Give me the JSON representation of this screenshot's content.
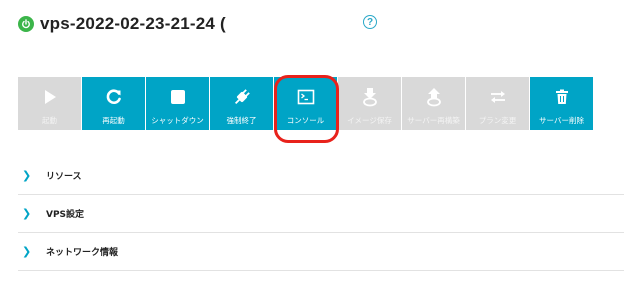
{
  "header": {
    "server_name": "vps-2022-02-23-21-24 (",
    "status_color": "#3cb54a",
    "help_label": "?"
  },
  "toolbar": {
    "accent_color": "#00a4c6",
    "disabled_color": "#d9d9d9",
    "buttons": [
      {
        "label": "起動",
        "icon": "play-icon",
        "enabled": false
      },
      {
        "label": "再起動",
        "icon": "restart-icon",
        "enabled": true
      },
      {
        "label": "シャットダウン",
        "icon": "stop-icon",
        "enabled": true
      },
      {
        "label": "強制終了",
        "icon": "plug-icon",
        "enabled": true
      },
      {
        "label": "コンソール",
        "icon": "console-icon",
        "enabled": true,
        "highlighted": true
      },
      {
        "label": "イメージ保存",
        "icon": "image-save-icon",
        "enabled": false
      },
      {
        "label": "サーバー再構築",
        "icon": "rebuild-icon",
        "enabled": false
      },
      {
        "label": "プラン変更",
        "icon": "plan-change-icon",
        "enabled": false
      },
      {
        "label": "サーバー削除",
        "icon": "trash-icon",
        "enabled": true
      }
    ]
  },
  "sections": [
    {
      "title": "リソース"
    },
    {
      "title": "VPS設定"
    },
    {
      "title": "ネットワーク情報"
    }
  ]
}
